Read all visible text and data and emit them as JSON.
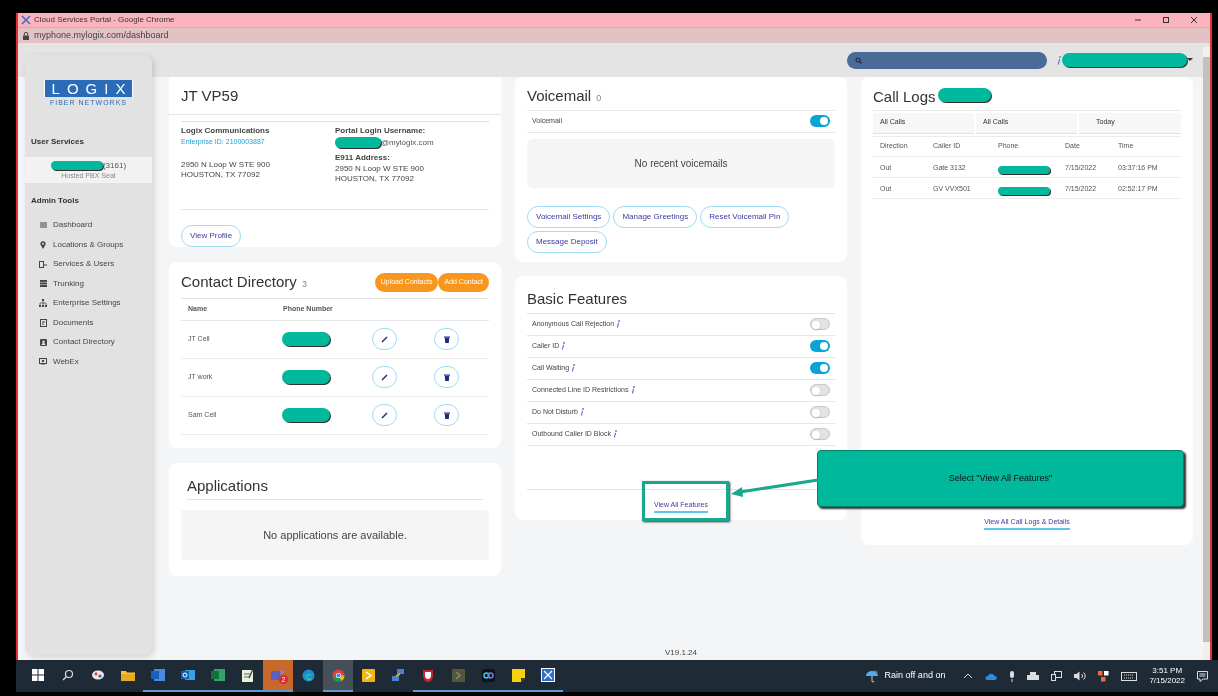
{
  "window": {
    "title": "Cloud Services Portal - Google Chrome",
    "url": "myphone.mylogix.com/dashboard"
  },
  "sidebar": {
    "logo": {
      "wordmark": "LOGIX",
      "tagline": "FIBER NETWORKS"
    },
    "user_services": {
      "heading": "User Services",
      "items": [
        {
          "extension": "(3161)",
          "subtitle": "Hosted PBX Seat",
          "selected": true
        }
      ]
    },
    "admin_tools": {
      "heading": "Admin Tools",
      "items": [
        {
          "kind": "dashboard",
          "label": "Dashboard"
        },
        {
          "kind": "location",
          "label": "Locations & Groups"
        },
        {
          "kind": "services",
          "label": "Services & Users"
        },
        {
          "kind": "trunking",
          "label": "Trunking"
        },
        {
          "kind": "enterprise",
          "label": "Enterprise Settings"
        },
        {
          "kind": "documents",
          "label": "Documents"
        },
        {
          "kind": "contacts",
          "label": "Contact Directory"
        },
        {
          "kind": "webex",
          "label": "WebEx"
        }
      ]
    }
  },
  "profile": {
    "title": "JT VP59",
    "company": "Logix Communications",
    "enterprise_id": "Enterprise ID: 2100003887",
    "address": [
      "2950 N Loop W STE 900",
      "HOUSTON, TX 77092"
    ],
    "login_label": "Portal Login Username:",
    "login_domain": "@mylogix.com",
    "e911_label": "E911 Address:",
    "e911_address": [
      "2950 N Loop W STE 900",
      "HOUSTON, TX 77092"
    ],
    "button": "View Profile"
  },
  "contact_directory": {
    "title": "Contact Directory",
    "count": "3",
    "buttons": [
      "Upload Contacts",
      "Add Contact"
    ],
    "columns": [
      "Name",
      "Phone Number"
    ],
    "rows": [
      {
        "name": "JT Cell"
      },
      {
        "name": "JT work"
      },
      {
        "name": "Sam Cell"
      }
    ]
  },
  "applications": {
    "title": "Applications",
    "empty": "No applications are available."
  },
  "voicemail": {
    "title": "Voicemail",
    "count": "0",
    "toggle": {
      "label": "Voicemail",
      "on": true
    },
    "empty": "No recent voicemails",
    "buttons": [
      "Voicemail Settings",
      "Manage Greetings",
      "Reset Voicemail Pin",
      "Message Deposit"
    ]
  },
  "basic_features": {
    "title": "Basic Features",
    "features": [
      {
        "label": "Anonymous Call Rejection",
        "on": false
      },
      {
        "label": "Caller ID",
        "on": true
      },
      {
        "label": "Call Waiting",
        "on": true
      },
      {
        "label": "Connected Line ID Restrictions",
        "on": false
      },
      {
        "label": "Do Not Disturb",
        "on": false
      },
      {
        "label": "Outbound Caller ID Block",
        "on": false
      }
    ],
    "link": "View All Features"
  },
  "call_logs": {
    "title": "Call Logs",
    "filters": [
      "All Calls",
      "All Calls",
      "Today"
    ],
    "columns": [
      "Direction",
      "Caller ID",
      "Phone",
      "Date",
      "Time"
    ],
    "rows": [
      {
        "direction": "Out",
        "caller_id": "Gate 3132",
        "date": "7/15/2022",
        "time": "03:37:16 PM"
      },
      {
        "direction": "Out",
        "caller_id": "GV VVX501",
        "date": "7/15/2022",
        "time": "02:52:17 PM"
      }
    ],
    "link": "View All Call Logs & Details"
  },
  "annotation": {
    "text": "Select \"View All Features\""
  },
  "footer": {
    "version": "V19.1.24"
  },
  "taskbar": {
    "apps": [
      {
        "kind": "start",
        "running": false,
        "selected": false,
        "attention": false
      },
      {
        "kind": "search",
        "running": false,
        "selected": false,
        "attention": false
      },
      {
        "kind": "paint",
        "running": false,
        "selected": false,
        "attention": false
      },
      {
        "kind": "folder",
        "running": false,
        "selected": false,
        "attention": false
      },
      {
        "kind": "word",
        "running": true,
        "selected": false,
        "attention": false
      },
      {
        "kind": "outlook",
        "running": true,
        "selected": false,
        "attention": false
      },
      {
        "kind": "excel",
        "running": true,
        "selected": false,
        "attention": false
      },
      {
        "kind": "notepad",
        "running": true,
        "selected": false,
        "attention": false
      },
      {
        "kind": "teams",
        "running": true,
        "selected": false,
        "attention": true,
        "badge": "2"
      },
      {
        "kind": "edge",
        "running": false,
        "selected": false,
        "attention": false
      },
      {
        "kind": "chrome",
        "running": true,
        "selected": true,
        "attention": false
      },
      {
        "kind": "launcher",
        "running": false,
        "selected": false,
        "attention": false
      },
      {
        "kind": "network",
        "running": false,
        "selected": false,
        "attention": false
      },
      {
        "kind": "shield",
        "running": true,
        "selected": false,
        "attention": false
      },
      {
        "kind": "console",
        "running": true,
        "selected": false,
        "attention": false
      },
      {
        "kind": "webex",
        "running": true,
        "selected": false,
        "attention": false
      },
      {
        "kind": "notes",
        "running": true,
        "selected": false,
        "attention": false
      },
      {
        "kind": "xapp",
        "running": true,
        "selected": false,
        "attention": false
      }
    ],
    "weather": "Rain off and on",
    "time": "3:51 PM",
    "date": "7/15/2022"
  }
}
